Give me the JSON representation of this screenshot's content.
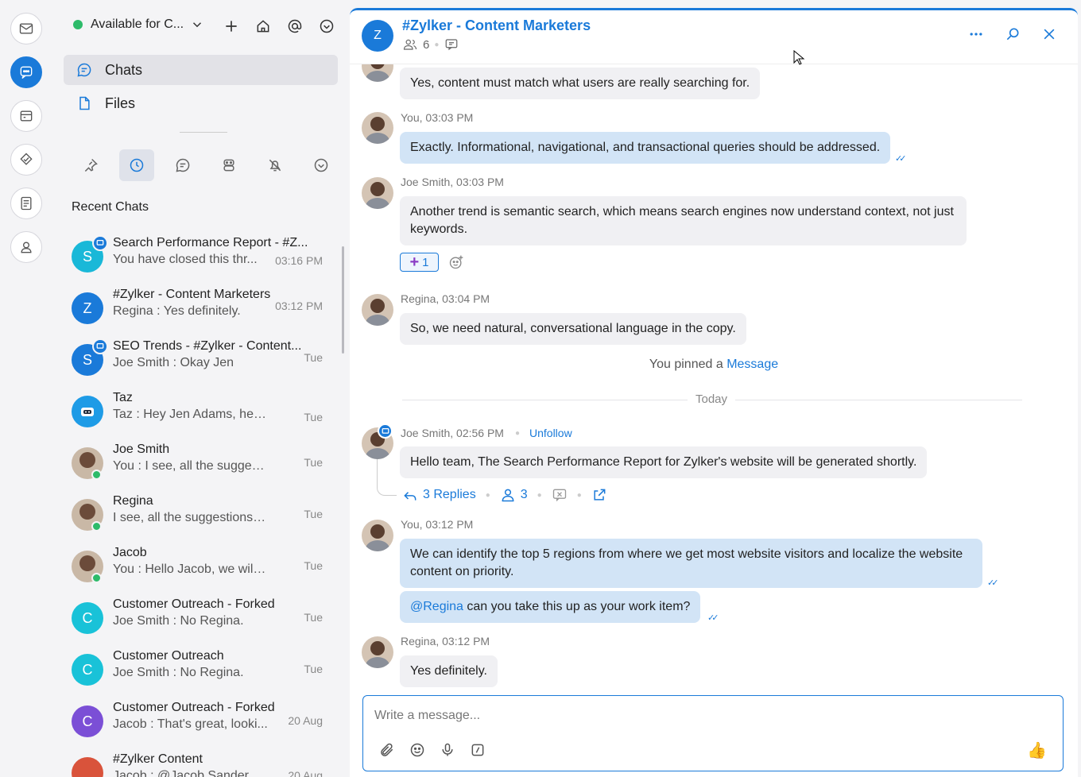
{
  "status": {
    "label": "Available for C..."
  },
  "nav": {
    "chats": "Chats",
    "files": "Files"
  },
  "recent_title": "Recent Chats",
  "chats": [
    {
      "name": "Search Performance Report - #Z...",
      "preview": "You have closed this thr...",
      "time": "03:16 PM",
      "initial": "S",
      "color": "#19b8d8"
    },
    {
      "name": "#Zylker - Content Marketers",
      "preview": "Regina : Yes definitely.",
      "time": "03:12 PM",
      "initial": "Z",
      "color": "#1a7ad9"
    },
    {
      "name": "SEO Trends - #Zylker - Content...",
      "preview": "Joe Smith : Okay Jen",
      "time": "Tue",
      "initial": "S",
      "color": "#1a7ad9"
    },
    {
      "name": "Taz",
      "preview": "Taz : Hey Jen Adams, here's y...",
      "time": "Tue",
      "initial": "",
      "color": "#1e9be6"
    },
    {
      "name": "Joe Smith",
      "preview": "You : I see, all the suggestion...",
      "time": "Tue",
      "initial": "",
      "color": "#c9b8a6"
    },
    {
      "name": "Regina",
      "preview": "I see, all the suggestions will i...",
      "time": "Tue",
      "initial": "",
      "color": "#c9b8a6"
    },
    {
      "name": "Jacob",
      "preview": "You : Hello Jacob, we will hav...",
      "time": "Tue",
      "initial": "",
      "color": "#c9b8a6"
    },
    {
      "name": "Customer Outreach - Forked",
      "preview": "Joe Smith : No Regina.",
      "time": "Tue",
      "initial": "C",
      "color": "#19c2d8"
    },
    {
      "name": "Customer Outreach",
      "preview": "Joe Smith : No Regina.",
      "time": "Tue",
      "initial": "C",
      "color": "#19c2d8"
    },
    {
      "name": "Customer Outreach - Forked",
      "preview": "Jacob : That's great, looki...",
      "time": "20 Aug",
      "initial": "C",
      "color": "#7b4fd6"
    },
    {
      "name": "#Zylker Content",
      "preview": "Jacob : @Jacob Sanders, i...",
      "time": "20 Aug",
      "initial": "",
      "color": "#d9533b"
    }
  ],
  "header": {
    "initial": "Z",
    "title": "#Zylker - Content Marketers",
    "members": "6"
  },
  "messages": {
    "m0": "Yes, content must match what users are really searching for.",
    "m1_meta": "You, 03:03 PM",
    "m1": "Exactly. Informational, navigational, and transactional queries should be addressed.",
    "m2_meta": "Joe Smith, 03:03 PM",
    "m2": "Another trend is semantic search, which means search engines now understand context, not just keywords.",
    "reaction_count": "1",
    "m3_meta": "Regina, 03:04 PM",
    "m3": "So, we need natural, conversational language in the copy.",
    "pinned_text": "You pinned a",
    "pinned_link": "Message",
    "today": "Today",
    "m4_meta": "Joe Smith, 02:56 PM",
    "unfollow": "Unfollow",
    "m4": "Hello team, The Search Performance Report for Zylker's website will be generated shortly.",
    "replies": "3 Replies",
    "participants": "3",
    "m5_meta": "You, 03:12 PM",
    "m5": "We can identify the top 5 regions from where we get most website visitors and localize the website content on priority.",
    "m6_mention": "@Regina",
    "m6": " can you take this up as your work item?",
    "m7_meta": "Regina, 03:12 PM",
    "m7": "Yes definitely."
  },
  "composer": {
    "placeholder": "Write a message..."
  },
  "colors": {
    "accent": "#1a7ad9",
    "online": "#2dbb6a",
    "my_bubble": "#d2e4f6"
  }
}
